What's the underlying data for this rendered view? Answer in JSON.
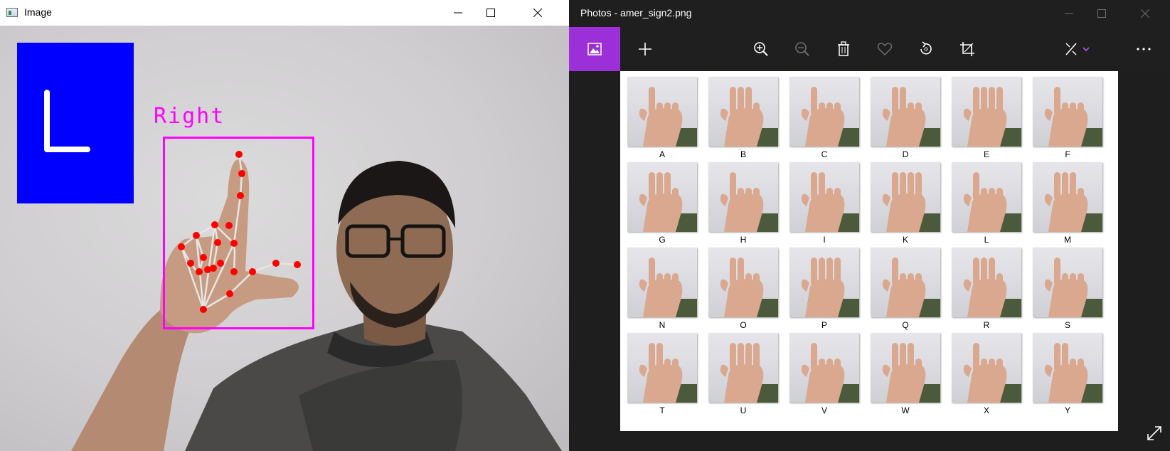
{
  "left_window": {
    "title": "Image",
    "overlay": {
      "detected_letter": "L",
      "handedness": "Right"
    }
  },
  "right_window": {
    "title": "Photos - amer_sign2.png",
    "toolbar": {
      "icons": [
        "image-icon",
        "add-icon",
        "zoom-in-icon",
        "zoom-out-icon",
        "delete-icon",
        "favorite-icon",
        "rotate-icon",
        "crop-icon",
        "edit-icon",
        "more-icon"
      ]
    },
    "sign_chart": {
      "letters": [
        "A",
        "B",
        "C",
        "D",
        "E",
        "F",
        "G",
        "H",
        "I",
        "K",
        "L",
        "M",
        "N",
        "O",
        "P",
        "Q",
        "R",
        "S",
        "T",
        "U",
        "V",
        "W",
        "X",
        "Y"
      ]
    }
  },
  "colors": {
    "accent_purple": "#9b30d9",
    "overlay_magenta": "#ff00ff",
    "letter_box_blue": "#0000ff",
    "landmark_red": "#ff0000"
  }
}
